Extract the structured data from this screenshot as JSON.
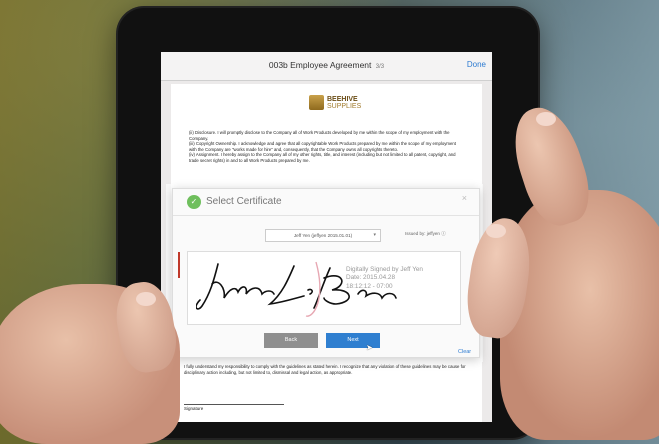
{
  "document": {
    "title": "003b Employee Agreement",
    "page_indicator": "3/3",
    "done_label": "Done",
    "company": {
      "line1": "BEEHIVE",
      "line2": "SUPPLIES"
    },
    "paragraphs": [
      "(ii)      Disclosure. I will promptly disclose to the Company all of Work Products developed by me within the scope of my employment with the Company.",
      "(iii)      Copyright Ownership. I acknowledge and agree that all copyrightable Work Products prepared by me within the scope of my employment with the Company are \"works made for hire\" and, consequently, that the Company owns all copyrights thereto.",
      "(iv)      Assignment. I hereby assign to the Company all of my other rights, title, and interest (including but not limited to all patent, copyright, and trade secret rights) in and to all Work Products prepared by me."
    ],
    "closing_text": "I fully understand my responsibility to comply with the guidelines as stated herein. I recognize that any violation of these guidelines may be cause for disciplinary action including, but not limited to, dismissal and legal action, as appropriate.",
    "signature_label": "Signature",
    "clear_label": "Clear"
  },
  "modal": {
    "title": "Select Certificate",
    "certificate_value": "Jeff Yen (jeffyen 2015.01.01)",
    "issued_by": "Issued by: jeffyen",
    "signer_name": "James L. Brown",
    "signed_by": "Digitally Signed by Jeff Yen",
    "date": "Date: 2015.04.28",
    "time": "18:12:12 - 07:00",
    "back_label": "Back",
    "next_label": "Next"
  }
}
